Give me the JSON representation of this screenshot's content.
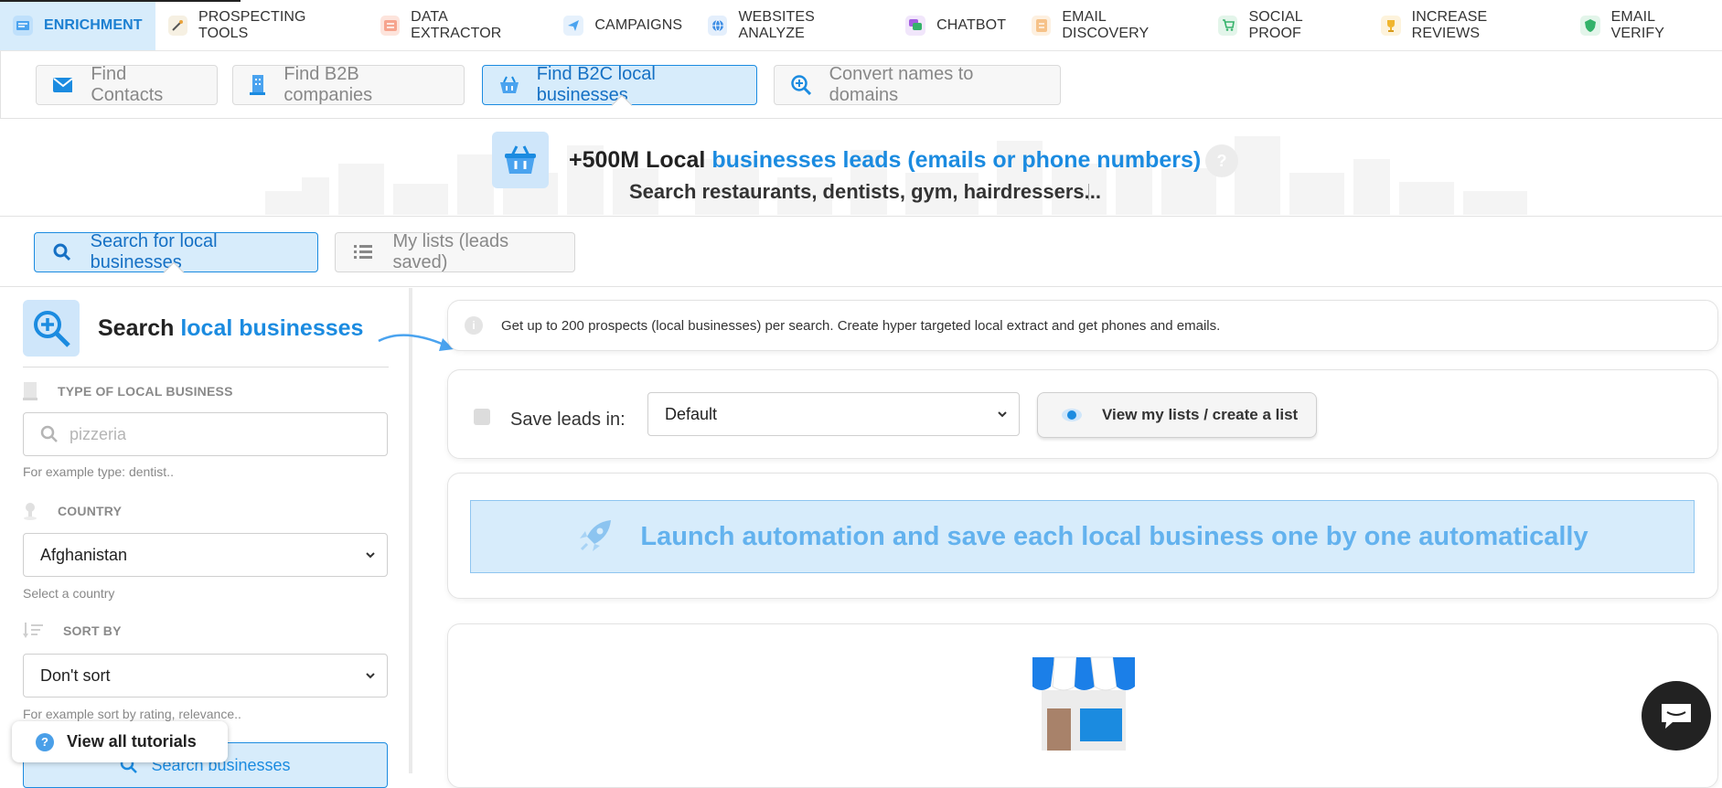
{
  "topnav": {
    "items": [
      {
        "label": "ENRICHMENT",
        "icon": "envelope-card-icon",
        "color": "#4aa3ef"
      },
      {
        "label": "PROSPECTING TOOLS",
        "icon": "magic-wand-icon",
        "color": "#e9a23b"
      },
      {
        "label": "DATA EXTRACTOR",
        "icon": "data-list-icon",
        "color": "#f26d4e"
      },
      {
        "label": "CAMPAIGNS",
        "icon": "paper-plane-icon",
        "color": "#4aa3ef"
      },
      {
        "label": "WEBSITES ANALYZE",
        "icon": "globe-icon",
        "color": "#3e8ee5"
      },
      {
        "label": "CHATBOT",
        "icon": "chat-bubble-icon",
        "color": "#a35ee0"
      },
      {
        "label": "EMAIL DISCOVERY",
        "icon": "document-icon",
        "color": "#f0a23e"
      },
      {
        "label": "SOCIAL PROOF",
        "icon": "cart-icon",
        "color": "#34b26a"
      },
      {
        "label": "INCREASE REVIEWS",
        "icon": "trophy-icon",
        "color": "#f0b52e"
      },
      {
        "label": "EMAIL VERIFY",
        "icon": "shield-check-icon",
        "color": "#34b26a"
      }
    ]
  },
  "subtabs": {
    "items": [
      {
        "label": "Find Contacts",
        "icon": "envelope-icon"
      },
      {
        "label": "Find B2B companies",
        "icon": "building-icon"
      },
      {
        "label": "Find B2C local businesses",
        "icon": "basket-icon"
      },
      {
        "label": "Convert names to domains",
        "icon": "magnifier-plus-icon"
      }
    ]
  },
  "hero": {
    "title_part1": "+500M Local ",
    "title_part2": "businesses leads (emails or phone numbers)",
    "subtitle": "Search restaurants, dentists, gym, hairdressers...",
    "help": "?"
  },
  "modes": {
    "search_label": "Search for local businesses",
    "lists_label": "My lists (leads saved)"
  },
  "sidebar": {
    "title_part1": "Search ",
    "title_part2": "local businesses",
    "type_label": "TYPE OF LOCAL BUSINESS",
    "type_placeholder": "pizzeria",
    "type_help": "For example type: dentist..",
    "country_label": "COUNTRY",
    "country_value": "Afghanistan",
    "country_help": "Select a country",
    "sort_label": "SORT BY",
    "sort_value": "Don't sort",
    "sort_help": "For example sort by rating, relevance..",
    "search_button": "Search businesses",
    "tutorials": "View all tutorials",
    "tutorials_icon": "?"
  },
  "info": {
    "text": "Get up to 200 prospects (local businesses) per search. Create hyper targeted local extract and get phones and emails.",
    "icon": "i"
  },
  "save": {
    "label": "Save leads in:",
    "list_value": "Default",
    "view_button": "View my lists / create a list"
  },
  "launch": {
    "label": "Launch automation and save each local business one by one automatically"
  },
  "colors": {
    "accent": "#1b8be0",
    "accent_light": "#d7ecfb"
  }
}
